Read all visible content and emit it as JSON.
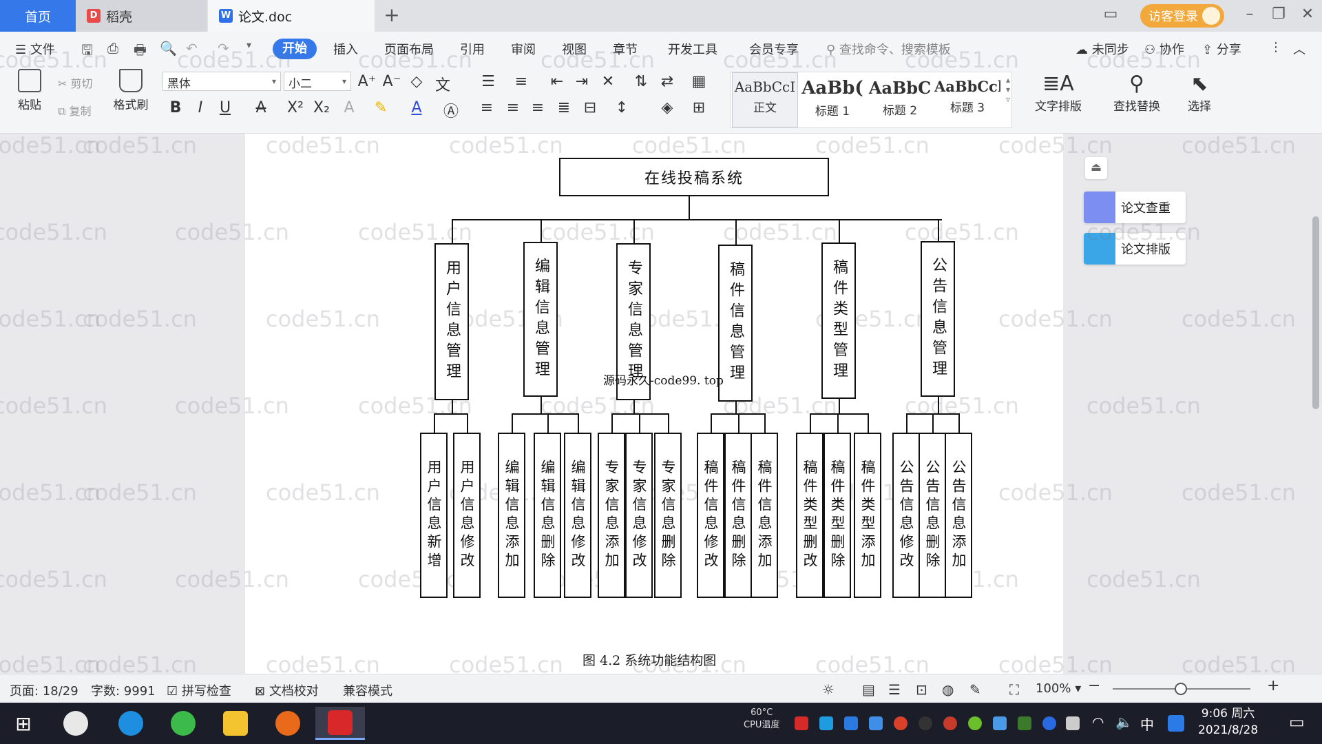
{
  "tabs": {
    "home": "首页",
    "daoke": "稻壳",
    "doc": "论文.doc",
    "new_tab": "+"
  },
  "titlebar": {
    "guest_login": "访客登录"
  },
  "menu": {
    "file": "文件",
    "items": [
      "开始",
      "插入",
      "页面布局",
      "引用",
      "审阅",
      "视图",
      "章节",
      "开发工具",
      "会员专享"
    ],
    "search_placeholder": "查找命令、搜索模板",
    "unsynced": "未同步",
    "collaborate": "协作",
    "share": "分享"
  },
  "toolbar": {
    "paste": "粘贴",
    "cut": "剪切",
    "copy": "复制",
    "format_painter": "格式刷",
    "font_name": "黑体",
    "font_size": "小二",
    "styles": [
      {
        "sample": "AaBbCcI",
        "name": "正文"
      },
      {
        "sample": "AaBb(",
        "name": "标题 1"
      },
      {
        "sample": "AaBbC",
        "name": "标题 2"
      },
      {
        "sample": "AaBbCcl",
        "name": "标题 3"
      }
    ],
    "text_layout": "文字排版",
    "find_replace": "查找替换",
    "select": "选择"
  },
  "side_panel": {
    "plagiarism_check": "论文查重",
    "thesis_layout": "论文排版"
  },
  "watermark": "code51.cn",
  "overlay_text": "源码永久-code99. top",
  "diagram": {
    "root": "在线投稿系统",
    "modules": [
      {
        "name": "用户信息管理",
        "children": [
          "用户信息新增",
          "用户信息修改"
        ]
      },
      {
        "name": "编辑信息管理",
        "children": [
          "编辑信息添加",
          "编辑信息删除",
          "编辑信息修改"
        ]
      },
      {
        "name": "专家信息管理",
        "children": [
          "专家信息添加",
          "专家信息修改",
          "专家信息删除"
        ]
      },
      {
        "name": "稿件信息管理",
        "children": [
          "稿件信息修改",
          "稿件信息删除",
          "稿件信息添加"
        ]
      },
      {
        "name": "稿件类型管理",
        "children": [
          "稿件类型删改",
          "稿件类型删除",
          "稿件类型添加"
        ]
      },
      {
        "name": "公告信息管理",
        "children": [
          "公告信息修改",
          "公告信息删除",
          "公告信息添加"
        ]
      }
    ],
    "caption": "图 4.2  系统功能结构图"
  },
  "statusbar": {
    "page": "页面: 18/29",
    "words": "字数: 9991",
    "spell_check": "拼写检查",
    "doc_proof": "文档校对",
    "compat_mode": "兼容模式",
    "zoom": "100%"
  },
  "taskbar": {
    "cpu_temp": "60°C",
    "cpu_label": "CPU温度",
    "ime": "中",
    "time": "9:06 周六",
    "date": "2021/8/28"
  }
}
